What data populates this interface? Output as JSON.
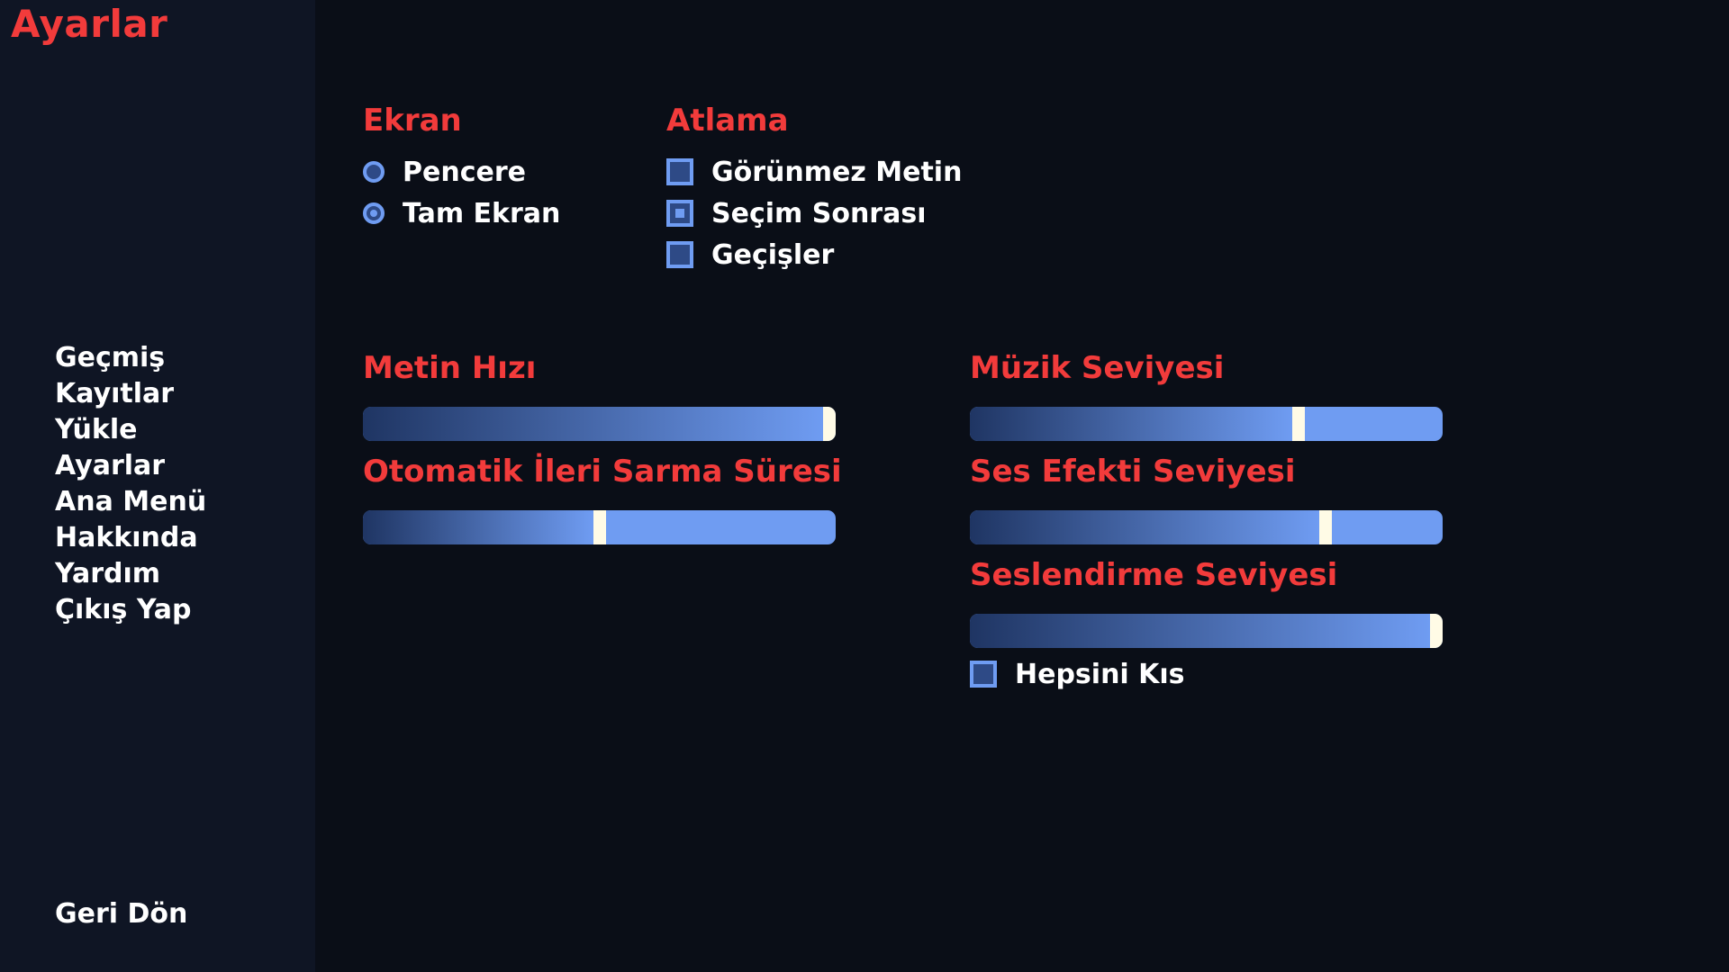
{
  "screen_title": "Ayarlar",
  "nav": {
    "items": [
      "Geçmiş",
      "Kayıtlar",
      "Yükle",
      "Ayarlar",
      "Ana Menü",
      "Hakkında",
      "Yardım",
      "Çıkış Yap"
    ],
    "back_label": "Geri Dön"
  },
  "display": {
    "title": "Ekran",
    "options": [
      {
        "label": "Pencere",
        "selected": false
      },
      {
        "label": "Tam Ekran",
        "selected": true
      }
    ]
  },
  "skip": {
    "title": "Atlama",
    "options": [
      {
        "label": "Görünmez Metin",
        "checked": false
      },
      {
        "label": "Seçim Sonrası",
        "checked": true
      },
      {
        "label": "Geçişler",
        "checked": false
      }
    ]
  },
  "sliders": {
    "text_speed": {
      "label": "Metin Hızı",
      "value": 1.0
    },
    "auto_forward": {
      "label": "Otomatik İleri Sarma Süresi",
      "value": 0.5
    },
    "music_volume": {
      "label": "Müzik Seviyesi",
      "value": 0.7
    },
    "sfx_volume": {
      "label": "Ses Efekti Seviyesi",
      "value": 0.76
    },
    "voice_volume": {
      "label": "Seslendirme Seviyesi",
      "value": 1.0
    }
  },
  "mute_all": {
    "label": "Hepsini Kıs",
    "checked": false
  },
  "colors": {
    "accent": "#f23b3b",
    "control": "#6f9cf2",
    "control_dark": "#1f3563",
    "thumb": "#fffbe6",
    "background": "#0a0e17",
    "sidebar": "#0f1524"
  }
}
